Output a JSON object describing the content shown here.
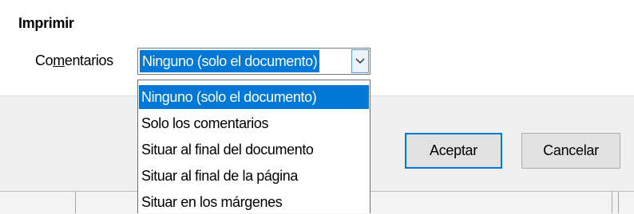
{
  "section": {
    "title": "Imprimir"
  },
  "comments_field": {
    "label_before": "Co",
    "label_underlined": "m",
    "label_after": "entarios",
    "value": "Ninguno (solo el documento)"
  },
  "dropdown": {
    "options": [
      "Ninguno (solo el documento)",
      "Solo los comentarios",
      "Situar al final del documento",
      "Situar al final de la página",
      "Situar en los márgenes"
    ]
  },
  "buttons": {
    "ok": "Aceptar",
    "cancel": "Cancelar"
  },
  "icons": {
    "combo_arrow": "chevron-down-icon"
  },
  "colors": {
    "accent": "#0078d7",
    "button_face": "#e1e1e1",
    "panel": "#f0f0f0"
  }
}
